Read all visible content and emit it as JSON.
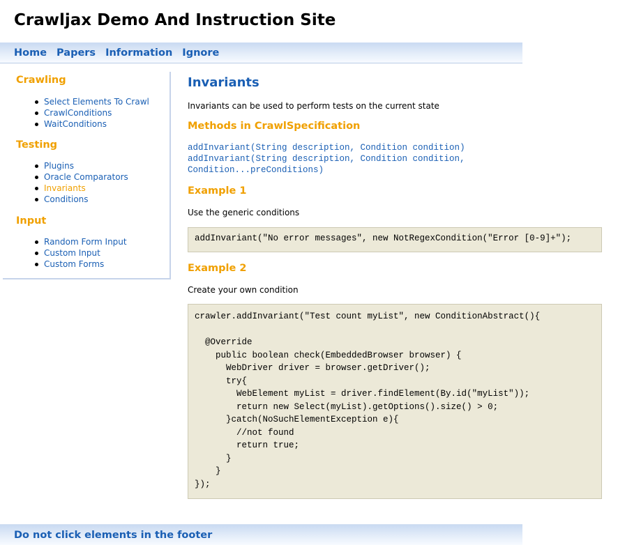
{
  "site": {
    "title": "Crawljax Demo And Instruction Site"
  },
  "nav": {
    "items": [
      {
        "label": "Home"
      },
      {
        "label": "Papers"
      },
      {
        "label": "Information"
      },
      {
        "label": "Ignore"
      }
    ]
  },
  "sidebar": {
    "sections": [
      {
        "heading": "Crawling",
        "items": [
          {
            "label": "Select Elements To Crawl"
          },
          {
            "label": "CrawlConditions"
          },
          {
            "label": "WaitConditions"
          }
        ]
      },
      {
        "heading": "Testing",
        "items": [
          {
            "label": "Plugins"
          },
          {
            "label": "Oracle Comparators"
          },
          {
            "label": "Invariants",
            "active": true
          },
          {
            "label": "Conditions"
          }
        ]
      },
      {
        "heading": "Input",
        "items": [
          {
            "label": "Random Form Input"
          },
          {
            "label": "Custom Input"
          },
          {
            "label": "Custom Forms"
          }
        ]
      }
    ]
  },
  "main": {
    "title": "Invariants",
    "intro": "Invariants can be used to perform tests on the current state",
    "methods_heading": "Methods in CrawlSpecification",
    "methods": "addInvariant(String description, Condition condition)\naddInvariant(String description, Condition condition,\nCondition...preConditions)",
    "example1_heading": "Example 1",
    "example1_text": "Use the generic conditions",
    "example1_code": "addInvariant(\"No error messages\", new NotRegexCondition(\"Error [0-9]+\");",
    "example2_heading": "Example 2",
    "example2_text": "Create your own condition",
    "example2_code": "crawler.addInvariant(\"Test count myList\", new ConditionAbstract(){\n\n  @Override\n    public boolean check(EmbeddedBrowser browser) {\n      WebDriver driver = browser.getDriver();\n      try{\n        WebElement myList = driver.findElement(By.id(\"myList\"));\n        return new Select(myList).getOptions().size() > 0;\n      }catch(NoSuchElementException e){\n        //not found\n        return true;\n      }\n    }\n});"
  },
  "footer": {
    "link": "Do not click elements in the footer"
  },
  "colors": {
    "link": "#1a5fb4",
    "accent": "#f0a000",
    "code_bg": "#ece9d8"
  }
}
